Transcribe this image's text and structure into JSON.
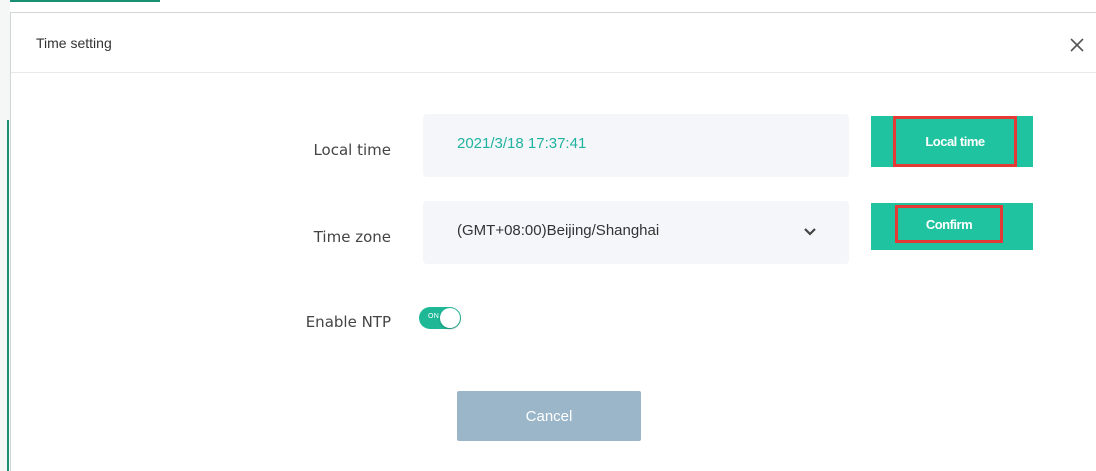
{
  "dialog": {
    "title": "Time setting",
    "close_icon": "close-icon"
  },
  "local_time": {
    "label": "Local time",
    "value": "2021/3/18 17:37:41",
    "button_label": "Local time"
  },
  "time_zone": {
    "label": "Time zone",
    "selected": "(GMT+08:00)Beijing/Shanghai",
    "dropdown_icon": "chevron-down-icon",
    "button_label": "Confirm"
  },
  "ntp": {
    "label": "Enable NTP",
    "toggle_text": "ON",
    "enabled": true
  },
  "footer": {
    "cancel_label": "Cancel"
  },
  "colors": {
    "accent": "#1fc3a0",
    "time_text": "#21b3a0",
    "highlight": "#e53935",
    "cancel": "#9ab6c8",
    "field_bg": "#f4f6f9"
  }
}
